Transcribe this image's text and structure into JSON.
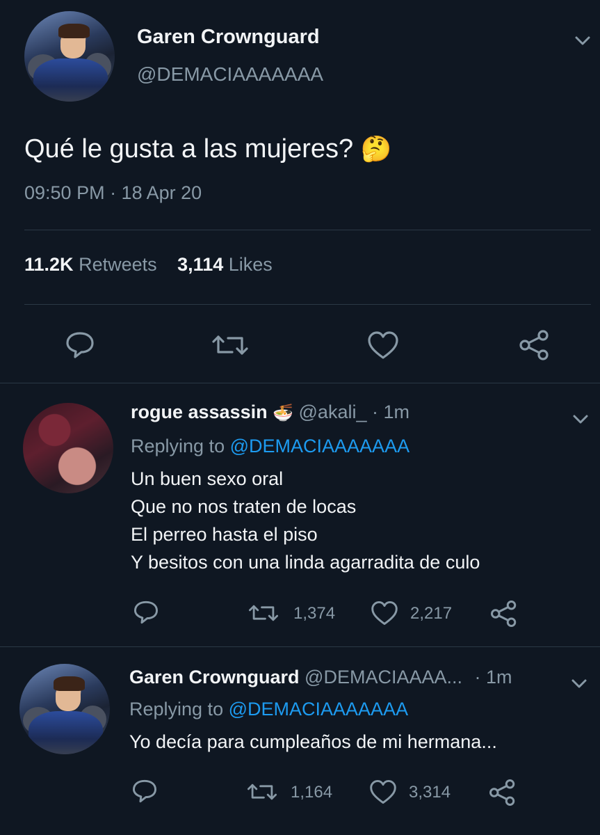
{
  "main_tweet": {
    "author_name": "Garen Crownguard",
    "author_handle": "@DEMACIAAAAAAA",
    "text": "Qué le gusta a las mujeres?",
    "emoji": "🤔",
    "timestamp": "09:50 PM · 18 Apr 20",
    "retweets_count": "11.2K",
    "retweets_label": "Retweets",
    "likes_count": "3,114",
    "likes_label": "Likes"
  },
  "replies": [
    {
      "author_name": "rogue assassin",
      "author_emoji": "🍜",
      "author_handle": "@akali_",
      "time": "· 1m",
      "replying_prefix": "Replying to",
      "replying_to": "@DEMACIAAAAAAA",
      "lines": [
        "Un buen sexo oral",
        "Que no nos traten de locas",
        "El perreo hasta el piso",
        "Y besitos con una linda agarradita de culo"
      ],
      "retweets": "1,374",
      "likes": "2,217"
    },
    {
      "author_name": "Garen Crownguard",
      "author_handle": "@DEMACIAAAA...",
      "time": "· 1m",
      "replying_prefix": "Replying to",
      "replying_to": "@DEMACIAAAAAAA",
      "lines": [
        "Yo decía para cumpleaños de mi hermana..."
      ],
      "retweets": "1,164",
      "likes": "3,314"
    }
  ],
  "colors": {
    "background": "#0f1722",
    "text": "#f2f4f6",
    "muted": "#8899a6",
    "link": "#1d9bf0",
    "divider": "#2b3945"
  },
  "icons": [
    "chevron-down-icon",
    "reply-icon",
    "retweet-icon",
    "like-icon",
    "share-icon"
  ]
}
